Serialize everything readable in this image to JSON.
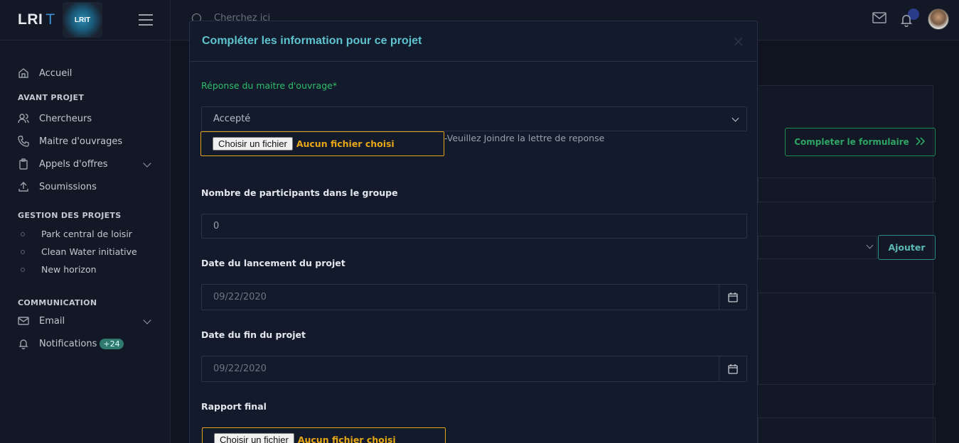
{
  "brand": {
    "name": "LRI",
    "suffix": "T",
    "logo_text": "LRIT"
  },
  "search": {
    "placeholder": "Cherchez ici"
  },
  "sidebar": {
    "home": "Accueil",
    "section_avant": "AVANT PROJET",
    "avant_items": [
      "Chercheurs",
      "Maitre d'ouvrages",
      "Appels d'offres",
      "Soumissions"
    ],
    "section_gestion": "GESTION DES PROJETS",
    "projects": [
      "Park central de loisir",
      "Clean Water initiative",
      "New horizon"
    ],
    "section_comm": "COMMUNICATION",
    "email": "Email",
    "notifications": "Notifications",
    "notif_badge": "+24"
  },
  "background": {
    "complete_button": "Completer le formulaire",
    "add_button": "Ajouter"
  },
  "modal": {
    "title": "Compléter les information pour ce projet",
    "close": "×",
    "response_label": "Réponse du maitre d'ouvrage*",
    "response_value": "Accepté",
    "file_button": "Choisir un fichier",
    "file_none": "Aucun fichier choisi",
    "file_hint": "-Veuillez Joindre la lettre de reponse",
    "participants_label": "Nombre de participants dans le groupe",
    "participants_value": "0",
    "start_label": "Date du lancement du projet",
    "start_value": "09/22/2020",
    "end_label": "Date du fin du projet",
    "end_value": "09/22/2020",
    "report_label": "Rapport final",
    "report_file_button": "Choisir un fichier",
    "report_file_none": "Aucun fichier choisi"
  },
  "colors": {
    "accent_teal": "#5fc3cf",
    "success_green": "#2fbf6a",
    "file_orange": "#e0a31c"
  }
}
